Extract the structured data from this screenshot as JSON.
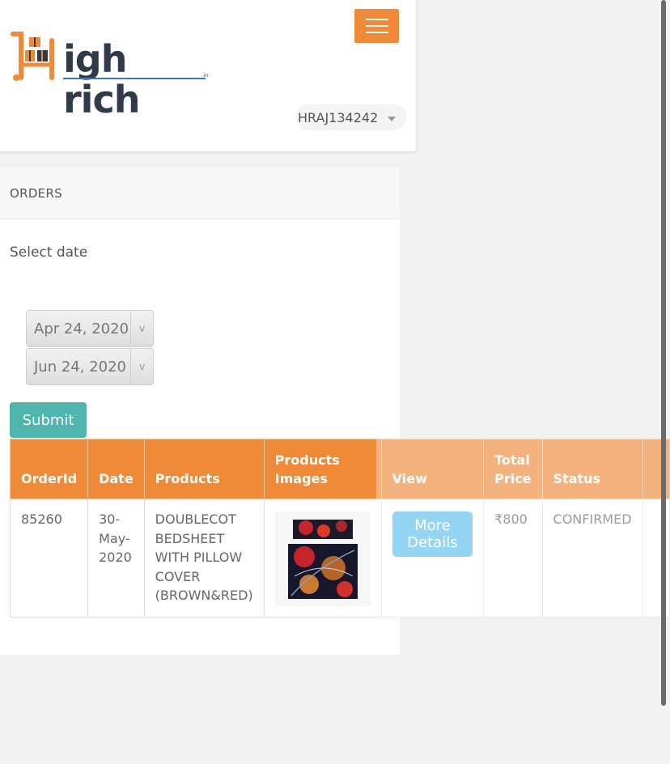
{
  "header": {
    "logo_text": "igh rich",
    "logo_suffix": ".in",
    "username": "HRAJ134242"
  },
  "panel": {
    "title": "ORDERS",
    "select_label": "Select date",
    "from_date": "Apr 24, 2020",
    "to_date": "Jun 24, 2020",
    "dropdown_glyph": "v",
    "submit_label": "Submit"
  },
  "table": {
    "headers": {
      "orderid": "OrderId",
      "date": "Date",
      "products": "Products",
      "images": "Products Images",
      "view": "View",
      "price": "Total Price",
      "status": "Status"
    },
    "rows": [
      {
        "orderid": "85260",
        "date": "30-May-2020",
        "product": "DOUBLECOT BEDSHEET WITH PILLOW COVER (BROWN&RED)",
        "view_label": "More Details",
        "price": "₹800",
        "status": "CONFIRMED"
      }
    ]
  },
  "colors": {
    "accent_orange": "#ef8a39",
    "submit_teal": "#4fb5ad",
    "details_blue": "#5cbfef"
  }
}
